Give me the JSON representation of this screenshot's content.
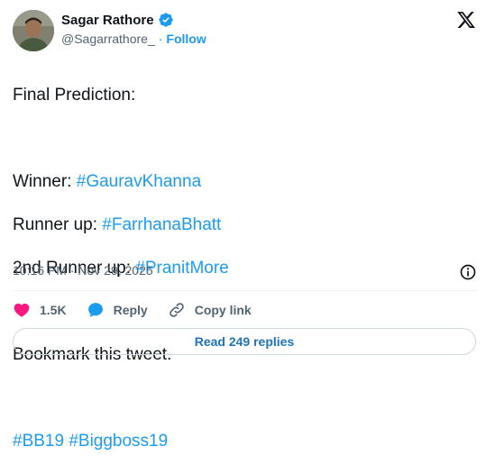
{
  "author": {
    "display_name": "Sagar Rathore",
    "handle": "@Sagarrathore_",
    "separator": "·",
    "follow_label": "Follow",
    "verified": true
  },
  "tweet": {
    "lines": [
      {
        "text": "Final Prediction:"
      },
      {
        "text": ""
      },
      {
        "prefix": "Winner: ",
        "hashtag": "#GauravKhanna"
      },
      {
        "prefix": "Runner up: ",
        "hashtag": "#FarrhanaBhatt"
      },
      {
        "prefix": "2nd Runner up: ",
        "hashtag": "#PranitMore"
      },
      {
        "text": ""
      },
      {
        "text": "Bookmark this tweet."
      },
      {
        "text": ""
      },
      {
        "hashtags": [
          "#BB19",
          "#Biggboss19"
        ]
      }
    ],
    "timestamp": "10:16 PM · Nov 29, 2025"
  },
  "actions": {
    "like_count": "1.5K",
    "reply_label": "Reply",
    "copy_link_label": "Copy link"
  },
  "read_replies_label": "Read 249 replies",
  "colors": {
    "accent": "#1d9bf0",
    "like": "#f91880",
    "text": "#0f1419",
    "muted": "#536471"
  },
  "icons": [
    "verified-badge-icon",
    "x-logo-icon",
    "info-icon",
    "heart-icon",
    "reply-bubble-icon",
    "link-icon"
  ]
}
